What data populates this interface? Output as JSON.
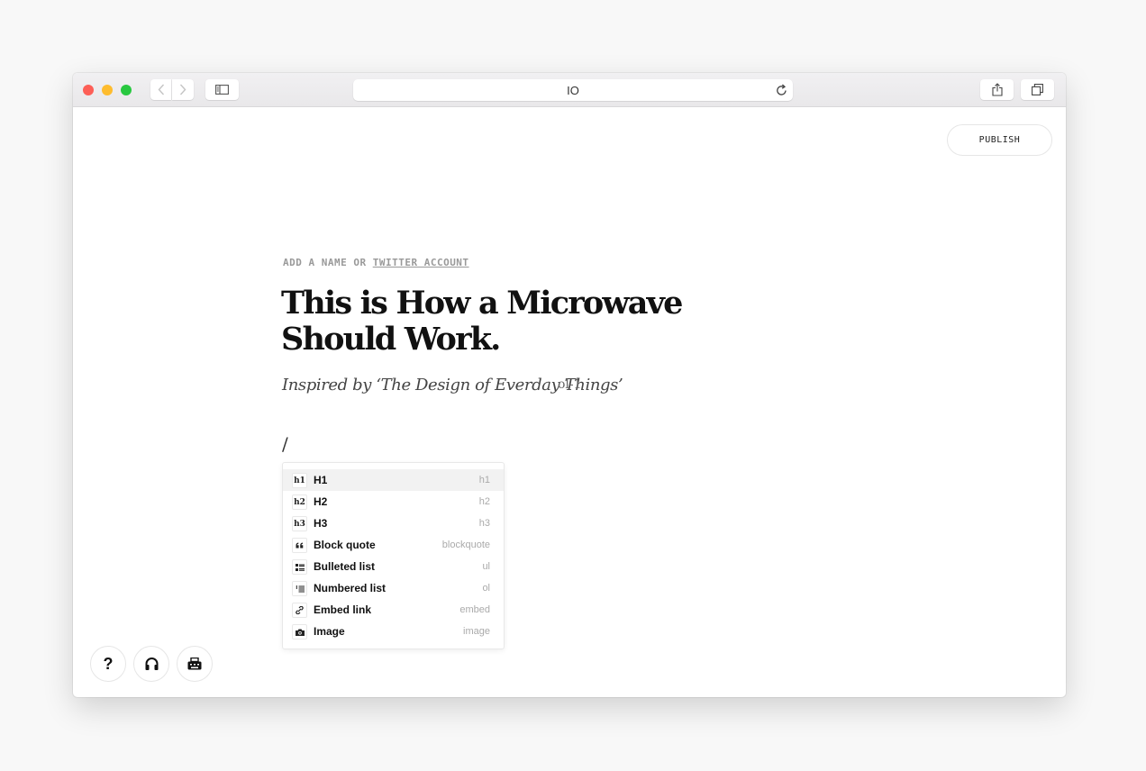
{
  "browser": {
    "address": "IO"
  },
  "editor": {
    "publish_label": "PUBLISH",
    "author_prefix": "ADD A NAME OR ",
    "author_link": "TWITTER ACCOUNT",
    "title": "This is How a Microwave Should Work.",
    "subtitle": "Inspired by ‘The Design of Everday Things’",
    "ghost_text": "ol-1",
    "slash": "/"
  },
  "menu": {
    "items": [
      {
        "icon": "h1",
        "label": "H1",
        "hint": "h1"
      },
      {
        "icon": "h2",
        "label": "H2",
        "hint": "h2"
      },
      {
        "icon": "h3",
        "label": "H3",
        "hint": "h3"
      },
      {
        "icon": "quote-icon",
        "label": "Block quote",
        "hint": "blockquote"
      },
      {
        "icon": "bullet-list-icon",
        "label": "Bulleted list",
        "hint": "ul"
      },
      {
        "icon": "numbered-list-icon",
        "label": "Numbered list",
        "hint": "ol"
      },
      {
        "icon": "link-icon",
        "label": "Embed link",
        "hint": "embed"
      },
      {
        "icon": "camera-icon",
        "label": "Image",
        "hint": "image"
      }
    ]
  },
  "footer": {
    "help_label": "?"
  },
  "colors": {
    "traffic_red": "#fd5f57",
    "traffic_yellow": "#febc2e",
    "traffic_green": "#28c840",
    "active_row": "#f2f2f2"
  }
}
